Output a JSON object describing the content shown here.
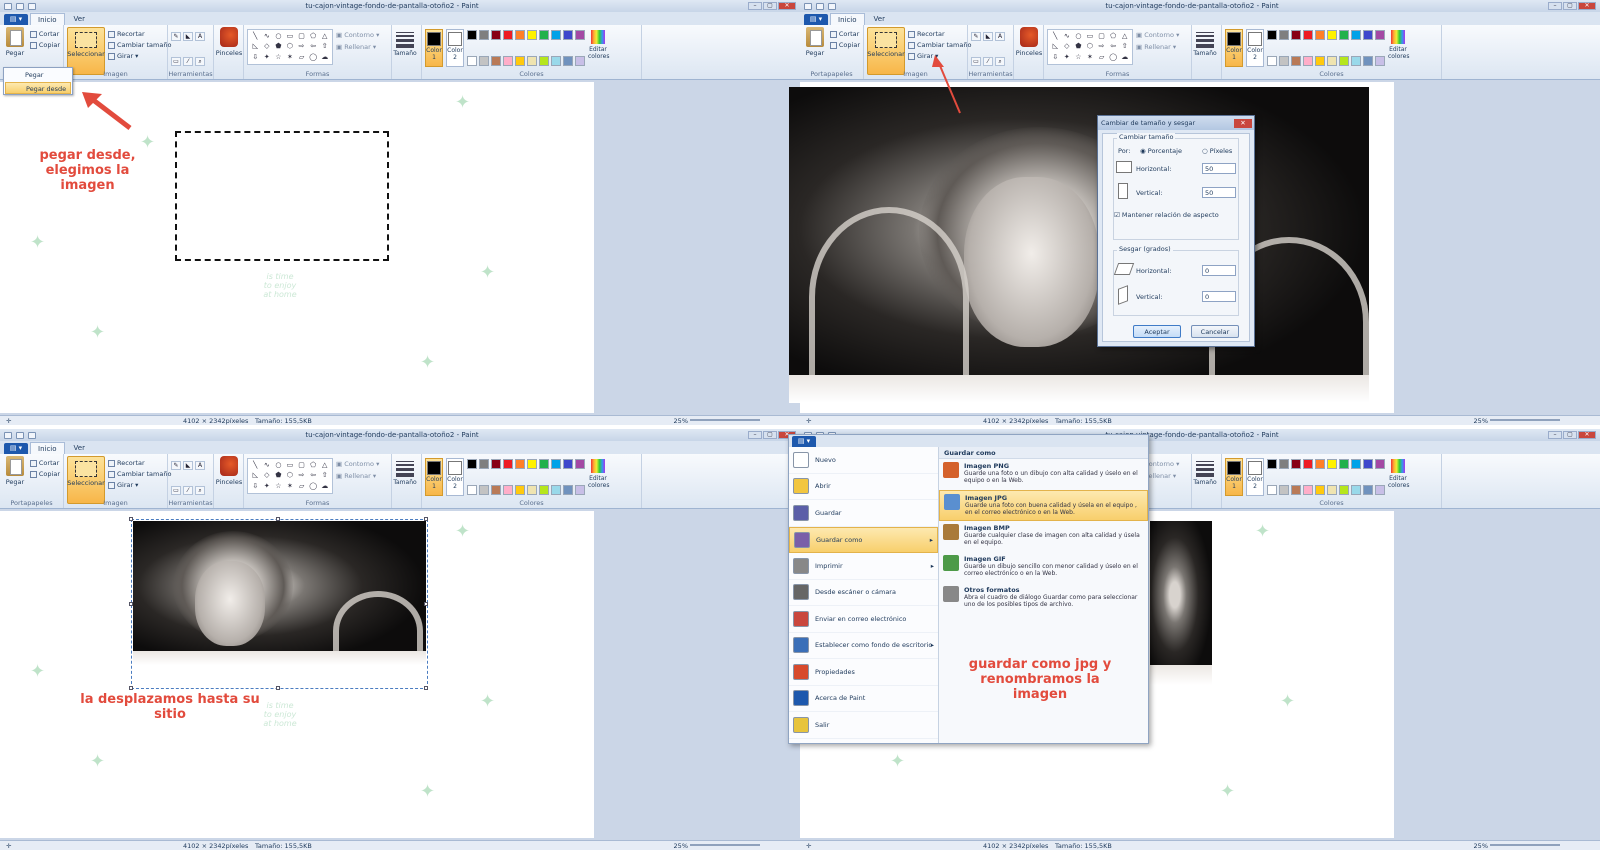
{
  "window": {
    "title": "tu-cajon-vintage-fondo-de-pantalla-otoño2 - Paint",
    "min": "–",
    "max": "▢",
    "close": "✕"
  },
  "tabs": {
    "file": "▤ ▾",
    "home": "Inicio",
    "view": "Ver"
  },
  "ribbon": {
    "paste": "Pegar",
    "cut": "Cortar",
    "copy": "Copiar",
    "clipboard_group": "Portapapeles",
    "select": "Seleccionar",
    "crop": "Recortar",
    "resize": "Cambiar tamaño",
    "rotate": "Girar",
    "image_group": "Imagen",
    "tools_group": "Herramientas",
    "brushes": "Pinceles",
    "shapes_group": "Formas",
    "outline": "Contorno",
    "fill": "Rellenar",
    "size": "Tamaño",
    "color1": "Color 1",
    "color2": "Color 2",
    "edit_colors": "Editar colores",
    "colors_group": "Colores",
    "palette": [
      "#000000",
      "#7f7f7f",
      "#880015",
      "#ed1c24",
      "#ff7f27",
      "#fff200",
      "#22b14c",
      "#00a2e8",
      "#3f48cc",
      "#a349a4",
      "#ffffff",
      "#c3c3c3",
      "#b97a57",
      "#ffaec9",
      "#ffc90e",
      "#efe4b0",
      "#b5e61d",
      "#99d9ea",
      "#7092be",
      "#c8bfe7"
    ]
  },
  "status": {
    "dimensions": "4102 × 2342píxeles",
    "filesize": "Tamaño: 155,5KB",
    "zoom": "25%",
    "pos": "✛"
  },
  "paste_menu": {
    "item1": "Pegar",
    "item2": "Pegar desde"
  },
  "annotations": {
    "q1": "pegar desde, elegimos la imagen",
    "q3": "la desplazamos hasta su sitio",
    "q4": "guardar como jpg y renombramos la imagen"
  },
  "motto": "is time to enjoy at home",
  "resize_dialog": {
    "title": "Cambiar de tamaño y sesgar",
    "resize_section": "Cambiar tamaño",
    "by": "Por:",
    "percent": "Porcentaje",
    "pixels": "Píxeles",
    "horizontal": "Horizontal:",
    "vertical": "Vertical:",
    "h_value": "50",
    "v_value": "50",
    "keep_ratio": "Mantener relación de aspecto",
    "skew_section": "Sesgar (grados)",
    "skew_h": "0",
    "skew_v": "0",
    "ok": "Aceptar",
    "cancel": "Cancelar"
  },
  "file_menu": {
    "items": [
      "Nuevo",
      "Abrir",
      "Guardar",
      "Guardar como",
      "Imprimir",
      "Desde escáner o cámara",
      "Enviar en correo electrónico",
      "Establecer como fondo de escritorio",
      "Propiedades",
      "Acerca de Paint",
      "Salir"
    ],
    "save_as_header": "Guardar como",
    "options": [
      {
        "title": "Imagen PNG",
        "desc": "Guarde una foto o un dibujo con alta calidad y úselo en el equipo o en la Web."
      },
      {
        "title": "Imagen JPG",
        "desc": "Guarde una foto con buena calidad y úsela en el equipo , en el correo electrónico o en la Web."
      },
      {
        "title": "Imagen BMP",
        "desc": "Guarde cualquier clase de imagen con alta calidad y úsela en el equipo."
      },
      {
        "title": "Imagen GIF",
        "desc": "Guarde un dibujo sencillo con menor calidad y úselo en el correo electrónico o en la Web."
      },
      {
        "title": "Otros formatos",
        "desc": "Abra el cuadro de diálogo Guardar como para seleccionar uno de los posibles tipos de archivo."
      }
    ]
  }
}
